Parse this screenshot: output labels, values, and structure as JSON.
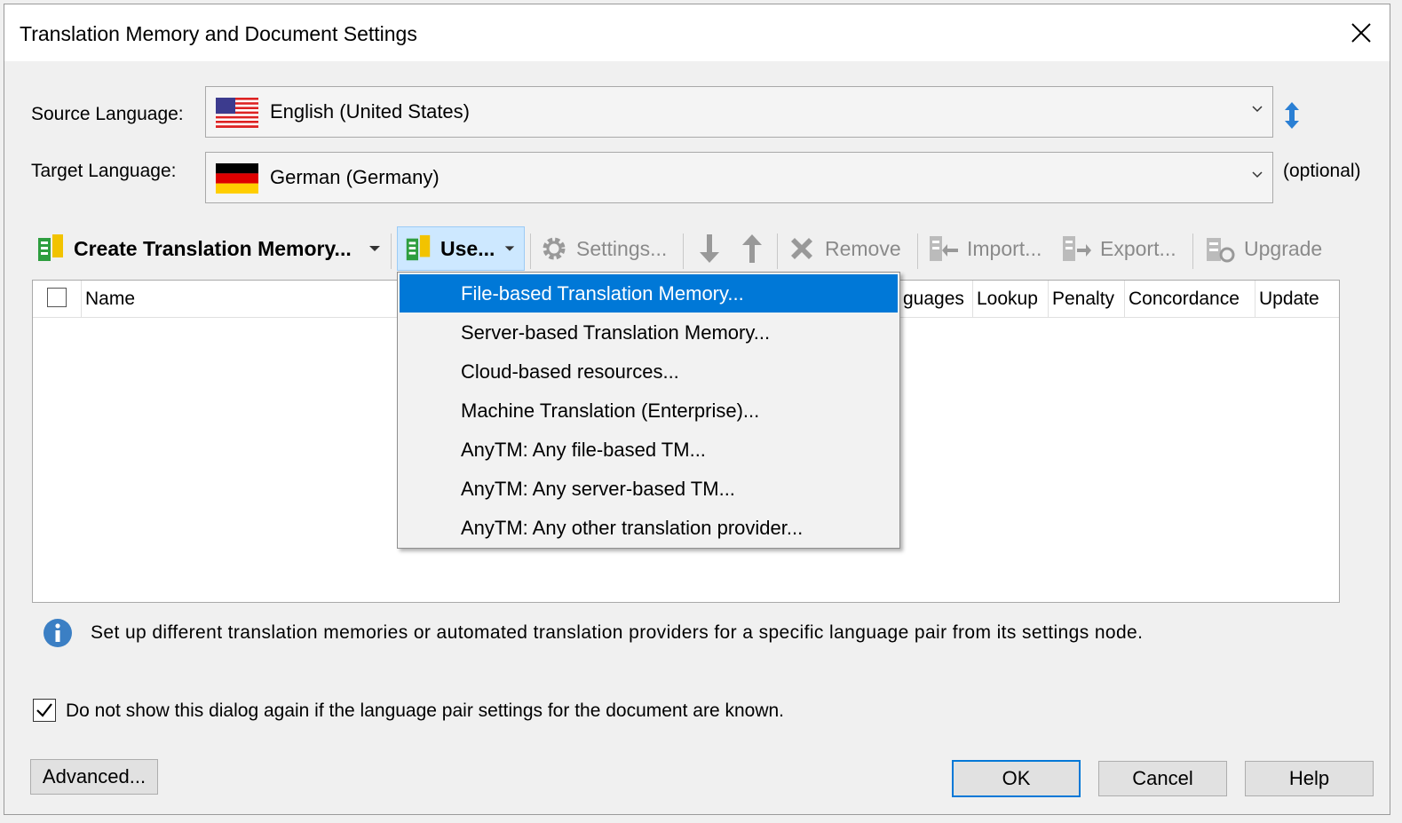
{
  "dialog": {
    "title": "Translation Memory and Document Settings"
  },
  "languages": {
    "source_label": "Source Language:",
    "source_value": "English (United States)",
    "target_label": "Target Language:",
    "target_value": "German (Germany)",
    "optional_label": "(optional)"
  },
  "toolbar": {
    "create_tm": "Create Translation Memory...",
    "use": "Use...",
    "settings": "Settings...",
    "remove": "Remove",
    "import": "Import...",
    "export": "Export...",
    "upgrade": "Upgrade"
  },
  "grid": {
    "columns": [
      "Name",
      "guages",
      "Lookup",
      "Penalty",
      "Concordance",
      "Update"
    ]
  },
  "use_menu": {
    "items": [
      "File-based Translation Memory...",
      "Server-based Translation Memory...",
      "Cloud-based resources...",
      "Machine Translation (Enterprise)...",
      "AnyTM: Any file-based TM...",
      "AnyTM: Any server-based TM...",
      "AnyTM: Any other translation provider..."
    ],
    "selected_index": 0
  },
  "info": {
    "text": "Set up different translation memories or automated translation providers for a specific language pair from its settings node."
  },
  "checkbox": {
    "label": "Do not show this dialog again if the language pair settings for the document are known.",
    "checked": true
  },
  "buttons": {
    "advanced": "Advanced...",
    "ok": "OK",
    "cancel": "Cancel",
    "help": "Help"
  },
  "colors": {
    "accent": "#0078d7",
    "tm_icon_green": "#2e9e3f",
    "tm_icon_yellow": "#f2c300"
  }
}
